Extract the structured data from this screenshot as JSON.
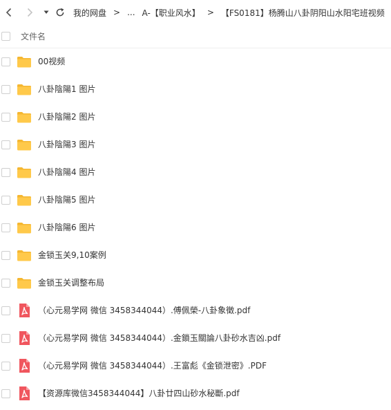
{
  "toolbar": {
    "back_icon": "chevron-left-icon",
    "forward_icon": "chevron-right-icon",
    "dropdown_icon": "caret-down-icon",
    "refresh_icon": "refresh-icon",
    "separator": ">",
    "breadcrumb": [
      "我的网盘",
      "...",
      "A-【职业风水】",
      "【FS0181】杨腾山八卦阴阳山水阳宅班视频"
    ]
  },
  "list_header": {
    "column_name": "文件名"
  },
  "files": [
    {
      "name": "00视频",
      "type": "folder"
    },
    {
      "name": "八卦陰陽1 图片",
      "type": "folder"
    },
    {
      "name": "八卦陰陽2 图片",
      "type": "folder"
    },
    {
      "name": "八卦陰陽3 图片",
      "type": "folder"
    },
    {
      "name": "八卦陰陽4 图片",
      "type": "folder"
    },
    {
      "name": "八卦陰陽5 图片",
      "type": "folder"
    },
    {
      "name": "八卦陰陽6 图片",
      "type": "folder"
    },
    {
      "name": "金锁玉关9,10案例",
      "type": "folder"
    },
    {
      "name": "金锁玉关调整布局",
      "type": "folder"
    },
    {
      "name": "（心元易学网 微信 3458344044）.傅佩榮-八卦象徵.pdf",
      "type": "pdf"
    },
    {
      "name": "（心元易学网 微信 3458344044）.金鎖玉關論八卦砂水吉凶.pdf",
      "type": "pdf"
    },
    {
      "name": "（心元易学网 微信 3458344044）.王富彪《金锁泄密》.PDF",
      "type": "pdf"
    },
    {
      "name": "【资源库微信3458344044】八卦廿四山砂水秘斷.pdf",
      "type": "pdf"
    }
  ],
  "colors": {
    "folder": "#FFC94A",
    "folder_tab": "#F5B731",
    "pdf": "#F0565E",
    "text": "#333333",
    "divider": "#EEEEEE"
  }
}
